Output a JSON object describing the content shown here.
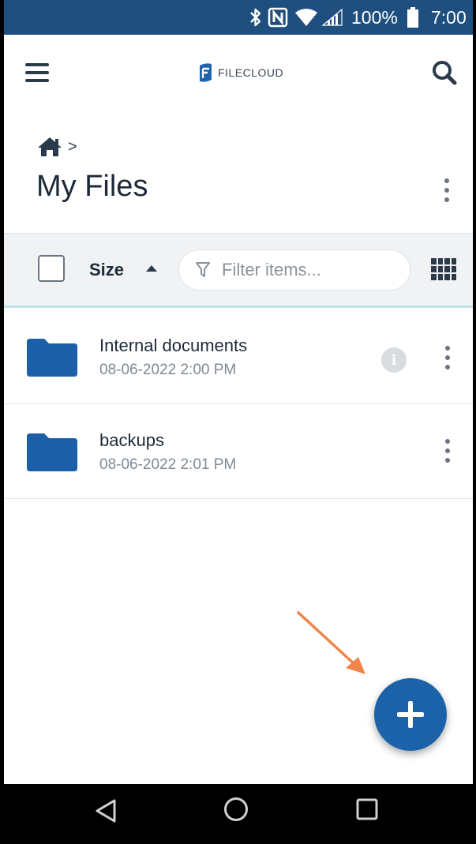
{
  "colors": {
    "statusbar": "#1e4f7e",
    "accent": "#1c62a8",
    "folder": "#1a5fa8",
    "toolbar_bg": "#f0f2f4",
    "annotation_arrow": "#f0844a"
  },
  "status_bar": {
    "battery": "100%",
    "time": "7:00",
    "icons": [
      "bluetooth-icon",
      "nfc-icon",
      "wifi-icon",
      "signal-icon",
      "battery-icon"
    ]
  },
  "top_bar": {
    "logo_text": "FILECLOUD",
    "menu_icon": "hamburger-icon",
    "search_icon": "search-icon"
  },
  "breadcrumb": {
    "home_icon": "home-icon",
    "separator": ">"
  },
  "page": {
    "title": "My Files"
  },
  "toolbar": {
    "sort_label": "Size",
    "sort_direction": "ascending",
    "filter_placeholder": "Filter items...",
    "view_icon": "grid-view-icon"
  },
  "files": [
    {
      "name": "Internal documents",
      "date": "08-06-2022 2:00 PM",
      "type": "folder",
      "has_info": true
    },
    {
      "name": "backups",
      "date": "08-06-2022 2:01 PM",
      "type": "folder",
      "has_info": false
    }
  ],
  "fab": {
    "icon": "plus-icon"
  },
  "nav_bar": {
    "icons": [
      "back-icon",
      "home-circle-icon",
      "recents-icon"
    ]
  }
}
